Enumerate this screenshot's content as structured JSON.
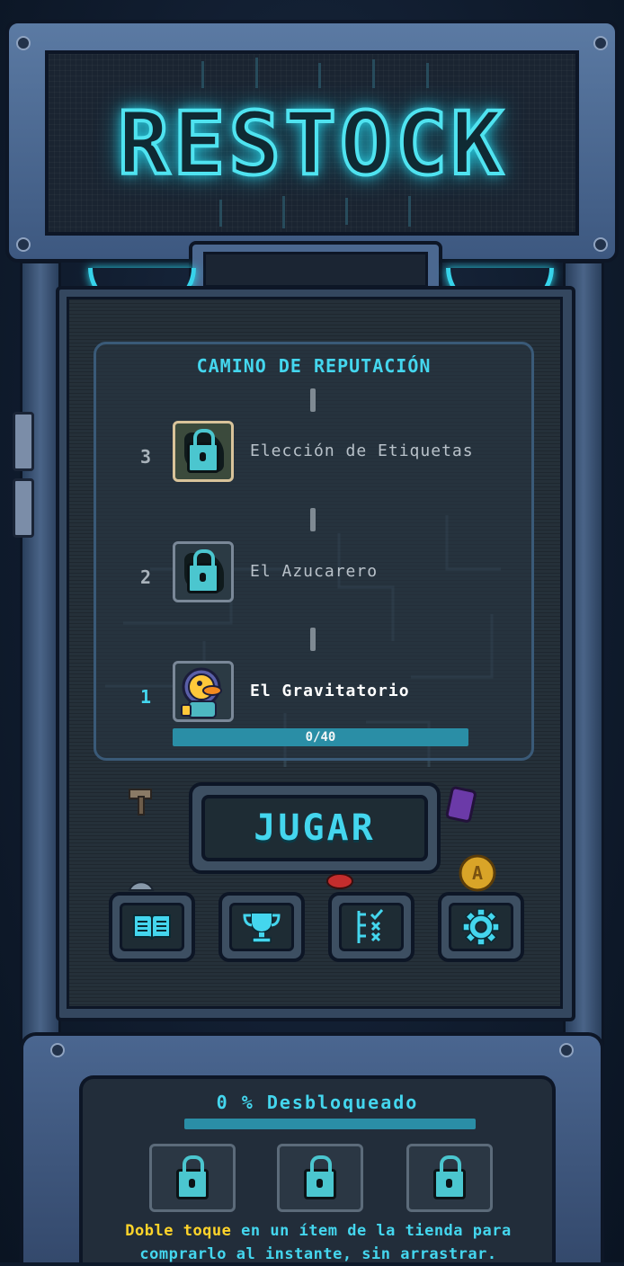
{
  "game": {
    "logo": "RESTOCK"
  },
  "reputation": {
    "title": "CAMINO DE REPUTACIÓN",
    "tiers": [
      {
        "rank": "3",
        "name": "Elección de Etiquetas",
        "locked": true
      },
      {
        "rank": "2",
        "name": "El Azucarero",
        "locked": true
      },
      {
        "rank": "1",
        "name": "El Gravitatorio",
        "locked": false
      }
    ],
    "progress_text": "0/40",
    "progress_current": 0,
    "progress_max": 40
  },
  "play_button": "JUGAR",
  "menu": [
    {
      "icon": "book-icon"
    },
    {
      "icon": "trophy-icon"
    },
    {
      "icon": "checklist-icon"
    },
    {
      "icon": "gear-icon"
    }
  ],
  "unlock": {
    "label": "0 % Desbloqueado",
    "percent": 0,
    "upgrades": [
      {
        "icon": "lock-icon",
        "locked": true
      },
      {
        "icon": "lock-icon",
        "locked": true
      },
      {
        "icon": "lock-icon",
        "locked": true
      }
    ]
  },
  "tip": {
    "highlight": "Doble toque",
    "line1_rest": " en un ítem de la tienda para",
    "line2": "comprarlo al instante, sin arrastrar."
  },
  "colors": {
    "accent": "#44d6ee",
    "highlight": "#ffd42a",
    "progress": "#2a8ea6"
  }
}
